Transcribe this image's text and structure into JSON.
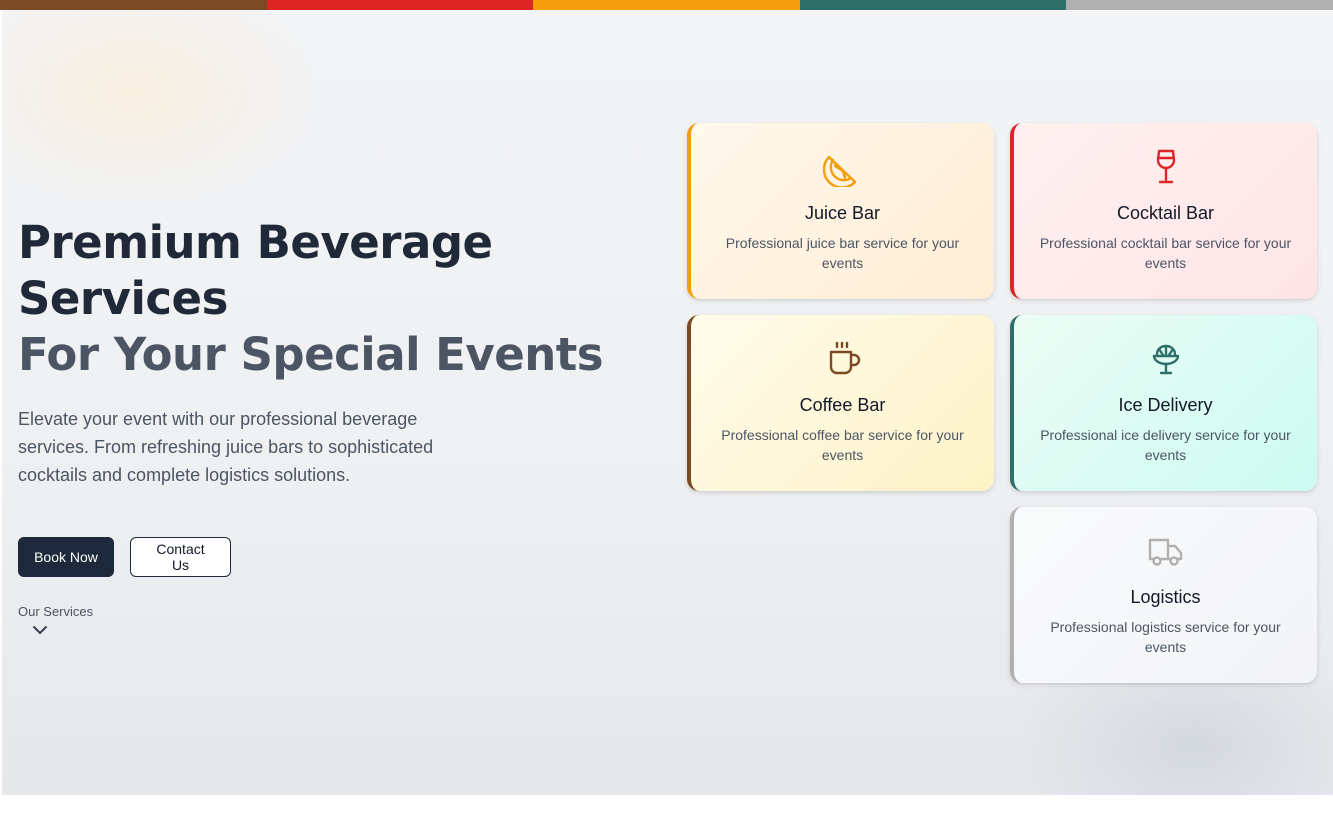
{
  "color_strip": [
    "#7a4a24",
    "#dc2626",
    "#f59e0b",
    "#2e6f6a",
    "#b0b0b0"
  ],
  "hero": {
    "headline_line1": "Premium Beverage Services",
    "headline_line2": "For Your Special Events",
    "subtext": "Elevate your event with our professional beverage services. From refreshing juice bars to sophisticated cocktails and complete logistics solutions.",
    "book_label": "Book Now",
    "contact_label": "Contact Us",
    "scroll_label": "Our Services"
  },
  "services": [
    {
      "title": "Juice Bar",
      "desc": "Professional juice bar service for your events",
      "icon": "orange-slice-icon",
      "accent": "#f59e0b",
      "bg_from": "#fff8ec",
      "bg_to": "#ffedd5"
    },
    {
      "title": "Cocktail Bar",
      "desc": "Professional cocktail bar service for your events",
      "icon": "wine-glass-icon",
      "accent": "#dc2626",
      "bg_from": "#fff1f1",
      "bg_to": "#ffe4e6"
    },
    {
      "title": "Coffee Bar",
      "desc": "Professional coffee bar service for your events",
      "icon": "coffee-cup-icon",
      "accent": "#7a4a24",
      "bg_from": "#fffbeb",
      "bg_to": "#fef3c7"
    },
    {
      "title": "Ice Delivery",
      "desc": "Professional ice delivery service for your events",
      "icon": "ice-cream-bowl-icon",
      "accent": "#2e6f6a",
      "bg_from": "#ecfdf5",
      "bg_to": "#ccfbf1"
    },
    {
      "title": "Logistics",
      "desc": "Professional logistics service for your events",
      "icon": "truck-icon",
      "accent": "#b0b0b0",
      "bg_from": "#f9fafb",
      "bg_to": "#f3f4f6"
    }
  ]
}
